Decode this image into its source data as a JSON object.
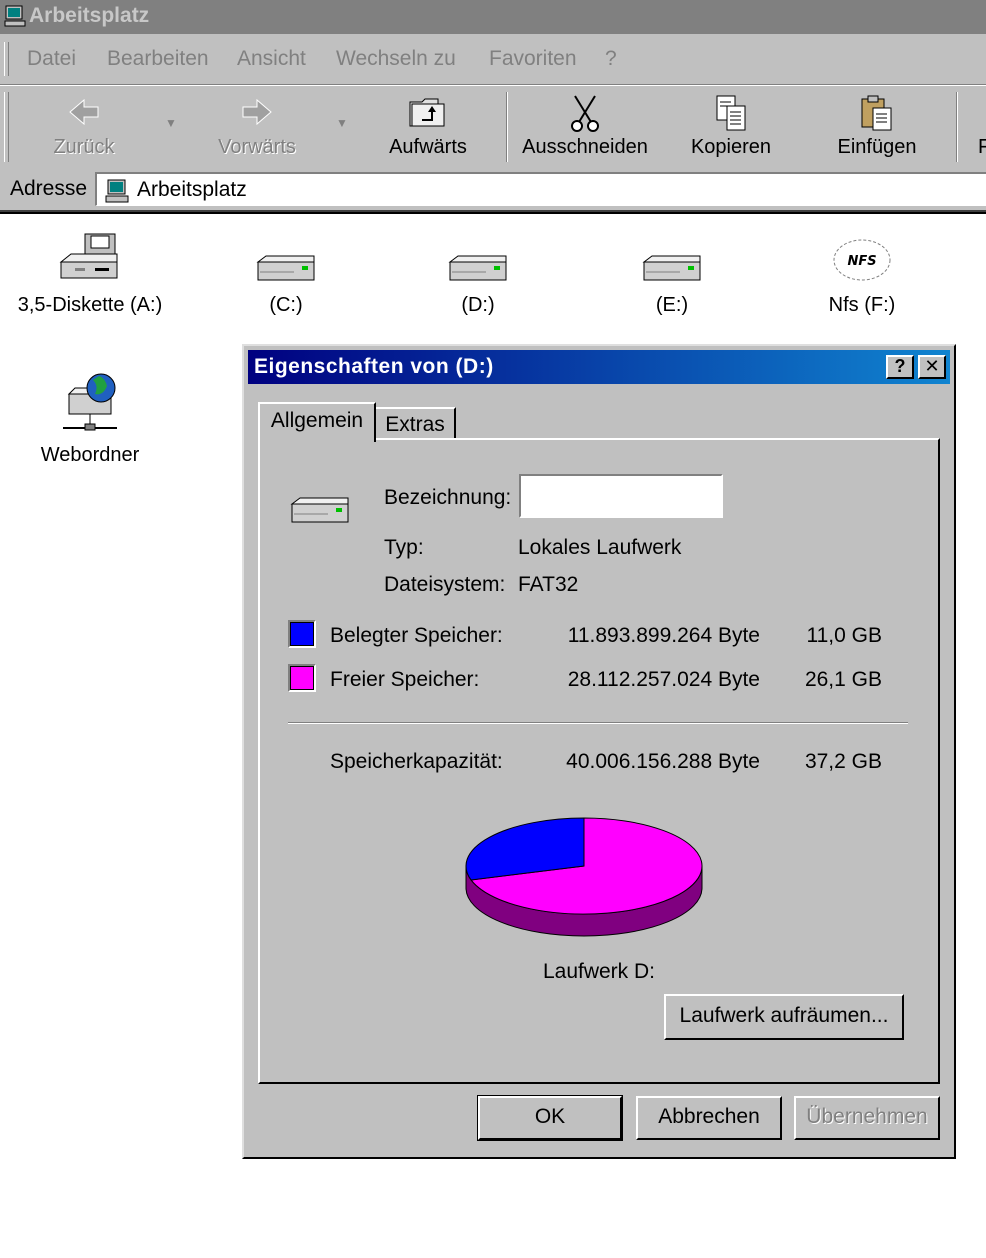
{
  "window": {
    "title": "Arbeitsplatz"
  },
  "menu": [
    {
      "label": "Datei"
    },
    {
      "label": "Bearbeiten"
    },
    {
      "label": "Ansicht"
    },
    {
      "label": "Wechseln zu"
    },
    {
      "label": "Favoriten"
    },
    {
      "label": "?"
    }
  ],
  "toolbar": {
    "back": "Zurück",
    "forward": "Vorwärts",
    "up": "Aufwärts",
    "cut": "Ausschneiden",
    "copy": "Kopieren",
    "paste": "Einfügen"
  },
  "address": {
    "label": "Adresse",
    "value": "Arbeitsplatz"
  },
  "drives": [
    {
      "label": "3,5-Diskette (A:)",
      "icon": "floppy-drive-icon"
    },
    {
      "label": "(C:)",
      "icon": "hard-drive-icon"
    },
    {
      "label": "(D:)",
      "icon": "hard-drive-icon"
    },
    {
      "label": "(E:)",
      "icon": "hard-drive-icon"
    },
    {
      "label": "Nfs (F:)",
      "icon": "nfs-drive-icon"
    },
    {
      "label": "Webordner",
      "icon": "web-folder-icon"
    }
  ],
  "dialog": {
    "title": "Eigenschaften von  (D:)",
    "tabs": [
      "Allgemein",
      "Extras"
    ],
    "active_tab": "Allgemein",
    "name_label": "Bezeichnung:",
    "name_value": "",
    "type_label": "Typ:",
    "type_value": "Lokales Laufwerk",
    "fs_label": "Dateisystem:",
    "fs_value": "FAT32",
    "used": {
      "label": "Belegter Speicher:",
      "bytes": "11.893.899.264 Byte",
      "gb": "11,0 GB",
      "color": "#0000ff"
    },
    "free": {
      "label": "Freier Speicher:",
      "bytes": "28.112.257.024 Byte",
      "gb": "26,1 GB",
      "color": "#ff00ff"
    },
    "capacity": {
      "label": "Speicherkapazität:",
      "bytes": "40.006.156.288 Byte",
      "gb": "37,2 GB"
    },
    "drive_caption": "Laufwerk D:",
    "cleanup_button": "Laufwerk aufräumen...",
    "ok": "OK",
    "cancel": "Abbrechen",
    "apply": "Übernehmen"
  },
  "pie": {
    "used_fraction": 0.297,
    "used_color": "#0000ff",
    "free_color": "#ff00ff",
    "free_side_color": "#800080",
    "used_side_color": "#000080"
  }
}
